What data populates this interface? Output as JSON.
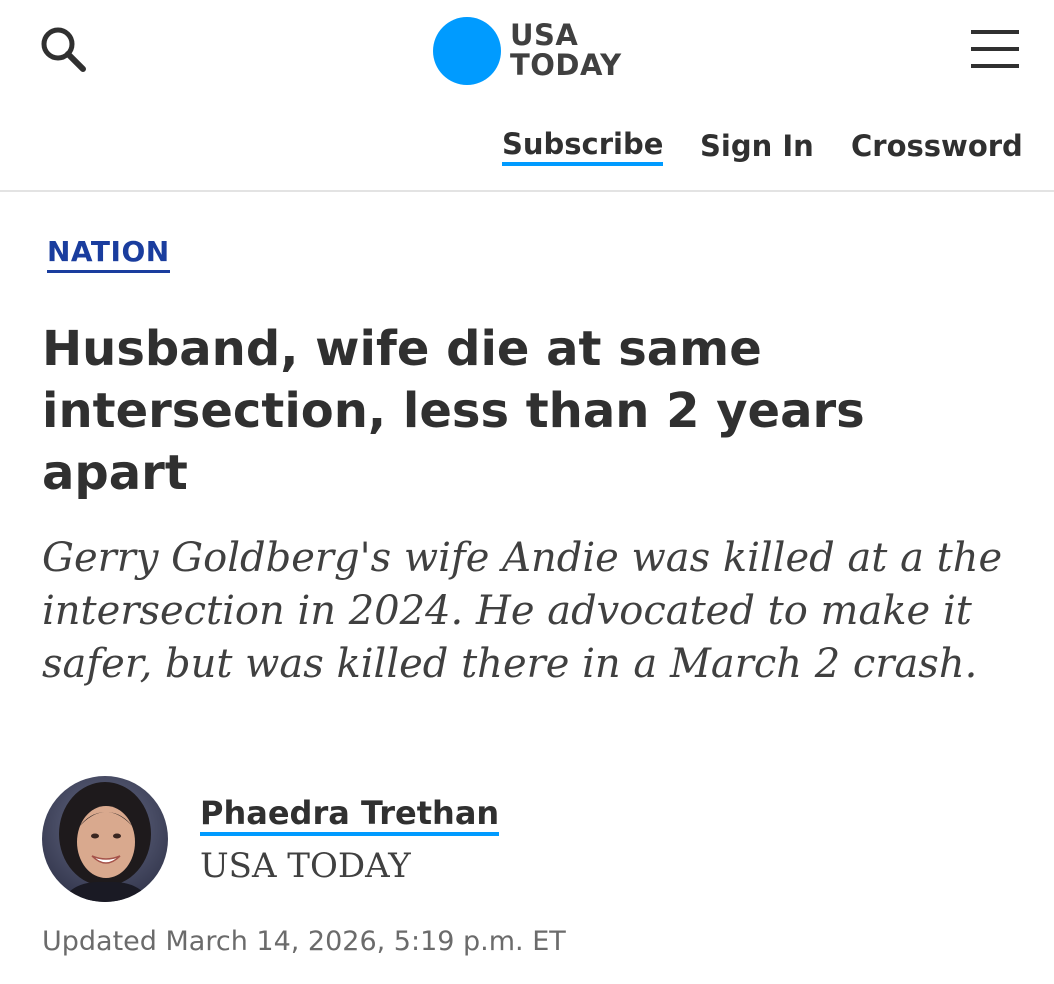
{
  "header": {
    "search_icon": "search-icon",
    "menu_icon": "hamburger-menu-icon",
    "logo": {
      "line1": "USA",
      "line2": "TODAY",
      "dot_color": "#009bff"
    },
    "nav": {
      "subscribe": "Subscribe",
      "sign_in": "Sign In",
      "crossword": "Crossword"
    }
  },
  "article": {
    "section": "NATION",
    "headline": "Husband, wife die at same intersection, less than 2 years apart",
    "deck": "Gerry Goldberg's wife Andie was killed at a the intersection in 2024. He advocated to make it safer, but was killed there in a March 2 crash.",
    "author": {
      "name": "Phaedra Trethan",
      "organization": "USA TODAY"
    },
    "updated": "Updated March 14, 2026, 5:19 p.m. ET"
  },
  "colors": {
    "accent": "#009bff",
    "section_link": "#1a3d9e",
    "text": "#303030"
  }
}
